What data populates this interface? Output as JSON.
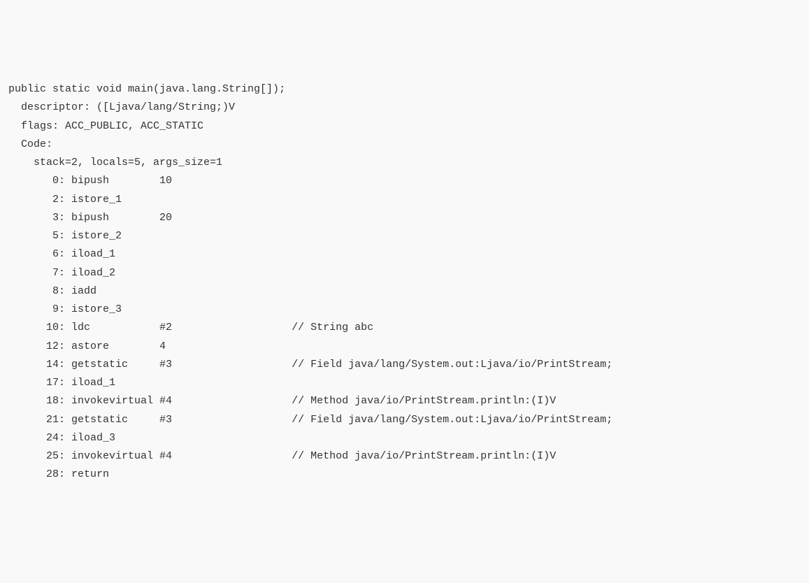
{
  "header": {
    "signature": "public static void main(java.lang.String[]);",
    "descriptor_label": "  descriptor: ",
    "descriptor_value": "([Ljava/lang/String;)V",
    "flags_label": "  flags: ",
    "flags_value": "ACC_PUBLIC, ACC_STATIC",
    "code_label": "  Code:",
    "stack_line": "    stack=2, locals=5, args_size=1"
  },
  "instructions": [
    {
      "offset": "       0",
      "op": "bipush",
      "arg": "10",
      "comment": ""
    },
    {
      "offset": "       2",
      "op": "istore_1",
      "arg": "",
      "comment": ""
    },
    {
      "offset": "       3",
      "op": "bipush",
      "arg": "20",
      "comment": ""
    },
    {
      "offset": "       5",
      "op": "istore_2",
      "arg": "",
      "comment": ""
    },
    {
      "offset": "       6",
      "op": "iload_1",
      "arg": "",
      "comment": ""
    },
    {
      "offset": "       7",
      "op": "iload_2",
      "arg": "",
      "comment": ""
    },
    {
      "offset": "       8",
      "op": "iadd",
      "arg": "",
      "comment": ""
    },
    {
      "offset": "       9",
      "op": "istore_3",
      "arg": "",
      "comment": ""
    },
    {
      "offset": "      10",
      "op": "ldc",
      "arg": "#2",
      "comment": "// String abc"
    },
    {
      "offset": "      12",
      "op": "astore",
      "arg": "4",
      "comment": ""
    },
    {
      "offset": "      14",
      "op": "getstatic",
      "arg": "#3",
      "comment": "// Field java/lang/System.out:Ljava/io/PrintStream;"
    },
    {
      "offset": "      17",
      "op": "iload_1",
      "arg": "",
      "comment": ""
    },
    {
      "offset": "      18",
      "op": "invokevirtual",
      "arg": "#4",
      "comment": "// Method java/io/PrintStream.println:(I)V"
    },
    {
      "offset": "      21",
      "op": "getstatic",
      "arg": "#3",
      "comment": "// Field java/lang/System.out:Ljava/io/PrintStream;"
    },
    {
      "offset": "      24",
      "op": "iload_3",
      "arg": "",
      "comment": ""
    },
    {
      "offset": "      25",
      "op": "invokevirtual",
      "arg": "#4",
      "comment": "// Method java/io/PrintStream.println:(I)V"
    },
    {
      "offset": "      28",
      "op": "return",
      "arg": "",
      "comment": ""
    }
  ]
}
